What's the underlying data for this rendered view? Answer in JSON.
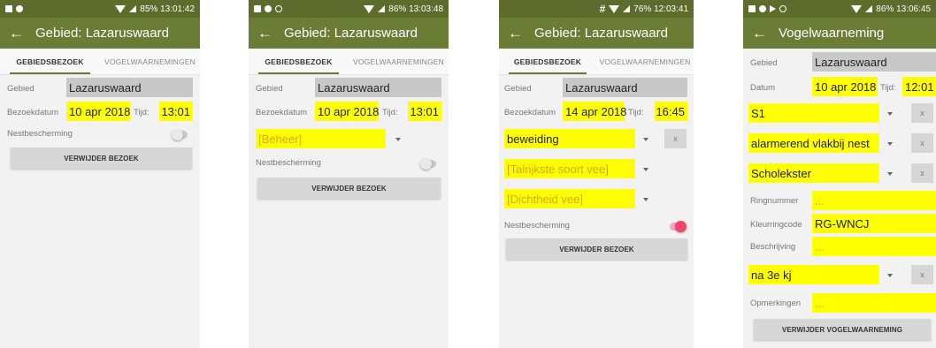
{
  "colors": {
    "statusbar": "#5d6b2c",
    "appbar": "#6b7c35",
    "field_highlight": "#ffff00",
    "switch_on": "#f4426a"
  },
  "screens": [
    {
      "status": {
        "time": "85% 13:01:42"
      },
      "title": "Gebied: Lazaruswaard",
      "tabs": [
        "GEBIEDSBEZOEK",
        "VOGELWAARNEMINGEN"
      ],
      "gebied_label": "Gebied",
      "gebied_value": "Lazaruswaard",
      "datum_label": "Bezoekdatum",
      "datum_value": "10 apr 2018",
      "tijd_label": "Tijd:",
      "tijd_value": "13:01",
      "nest_label": "Nestbescherming",
      "nest_on": false,
      "button": "VERWIJDER BEZOEK"
    },
    {
      "status": {
        "time": "86% 13:03:48"
      },
      "title": "Gebied: Lazaruswaard",
      "tabs": [
        "GEBIEDSBEZOEK",
        "VOGELWAARNEMINGEN"
      ],
      "gebied_label": "Gebied",
      "gebied_value": "Lazaruswaard",
      "datum_label": "Bezoekdatum",
      "datum_value": "10 apr 2018",
      "tijd_label": "Tijd:",
      "tijd_value": "13:01",
      "beheer_placeholder": "[Beheer]",
      "nest_label": "Nestbescherming",
      "nest_on": false,
      "button": "VERWIJDER BEZOEK"
    },
    {
      "status": {
        "time": "76% 12:03:41"
      },
      "title": "Gebied: Lazaruswaard",
      "tabs": [
        "GEBIEDSBEZOEK",
        "VOGELWAARNEMINGEN"
      ],
      "gebied_label": "Gebied",
      "gebied_value": "Lazaruswaard",
      "datum_label": "Bezoekdatum",
      "datum_value": "14 apr 2018",
      "tijd_label": "Tijd:",
      "tijd_value": "16:45",
      "beheer_value": "beweiding",
      "clear": "x",
      "vee_placeholder": "[Talrijkste soort vee]",
      "dichtheid_placeholder": "[Dichtheid vee]",
      "nest_label": "Nestbescherming",
      "nest_on": true,
      "button": "VERWIJDER BEZOEK"
    },
    {
      "status": {
        "time": "86% 13:06:45"
      },
      "title": "Vogelwaarneming",
      "gebied_label": "Gebied",
      "gebied_value": "Lazaruswaard",
      "datum_label": "Datum",
      "datum_value": "10 apr 2018",
      "tijd_label": "Tijd:",
      "tijd_value": "12:01",
      "dropdown1": "S1",
      "dropdown2": "alarmerend vlakbij nest",
      "dropdown3": "Scholekster",
      "clear": "x",
      "ring_label": "Ringnummer",
      "ring_placeholder": "...",
      "kleur_label": "Kleurringcode",
      "kleur_value": "RG-WNCJ",
      "beschr_label": "Beschrijving",
      "beschr_placeholder": "...",
      "leeftijd": "na 3e kj",
      "opm_label": "Opmerkingen",
      "opm_placeholder": "...",
      "button": "VERWIJDER VOGELWAARNEMING"
    }
  ]
}
